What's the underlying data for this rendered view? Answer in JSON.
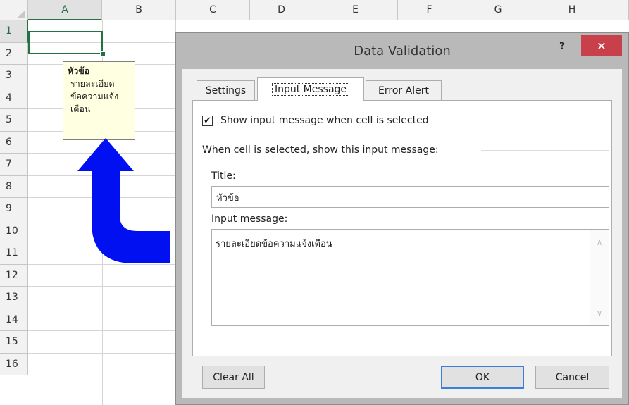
{
  "sheet": {
    "columns": [
      "A",
      "B",
      "C",
      "D",
      "E",
      "F",
      "G",
      "H"
    ],
    "rows": [
      "1",
      "2",
      "3",
      "4",
      "5",
      "6",
      "7",
      "8",
      "9",
      "10",
      "11",
      "12",
      "13",
      "14",
      "15",
      "16"
    ],
    "selected_column": "A",
    "selected_row": "1"
  },
  "tooltip": {
    "title": "หัวข้อ",
    "body": "รายละเอียด\nข้อความแจ้ง\nเตือน"
  },
  "dialog": {
    "title": "Data Validation",
    "help_label": "?",
    "close_label": "✕",
    "tabs": [
      {
        "label": "Settings",
        "active": false
      },
      {
        "label": "Input Message",
        "active": true
      },
      {
        "label": "Error Alert",
        "active": false
      }
    ],
    "show_message_checked": true,
    "show_message_label": "Show input message when cell is selected",
    "group_label": "When cell is selected, show this input message:",
    "title_label": "Title:",
    "title_value": "หัวข้อ",
    "message_label": "Input message:",
    "message_value": "รายละเอียดข้อความแจ้งเตือน",
    "buttons": {
      "clear_all": "Clear All",
      "ok": "OK",
      "cancel": "Cancel"
    }
  },
  "colors": {
    "excel_green": "#217346",
    "tooltip_bg": "#ffffe1",
    "arrow_blue": "#0010f0",
    "close_red": "#c8404a"
  },
  "icons": {
    "arrow": "blue-up-arrow-icon",
    "check": "checkmark-icon"
  }
}
